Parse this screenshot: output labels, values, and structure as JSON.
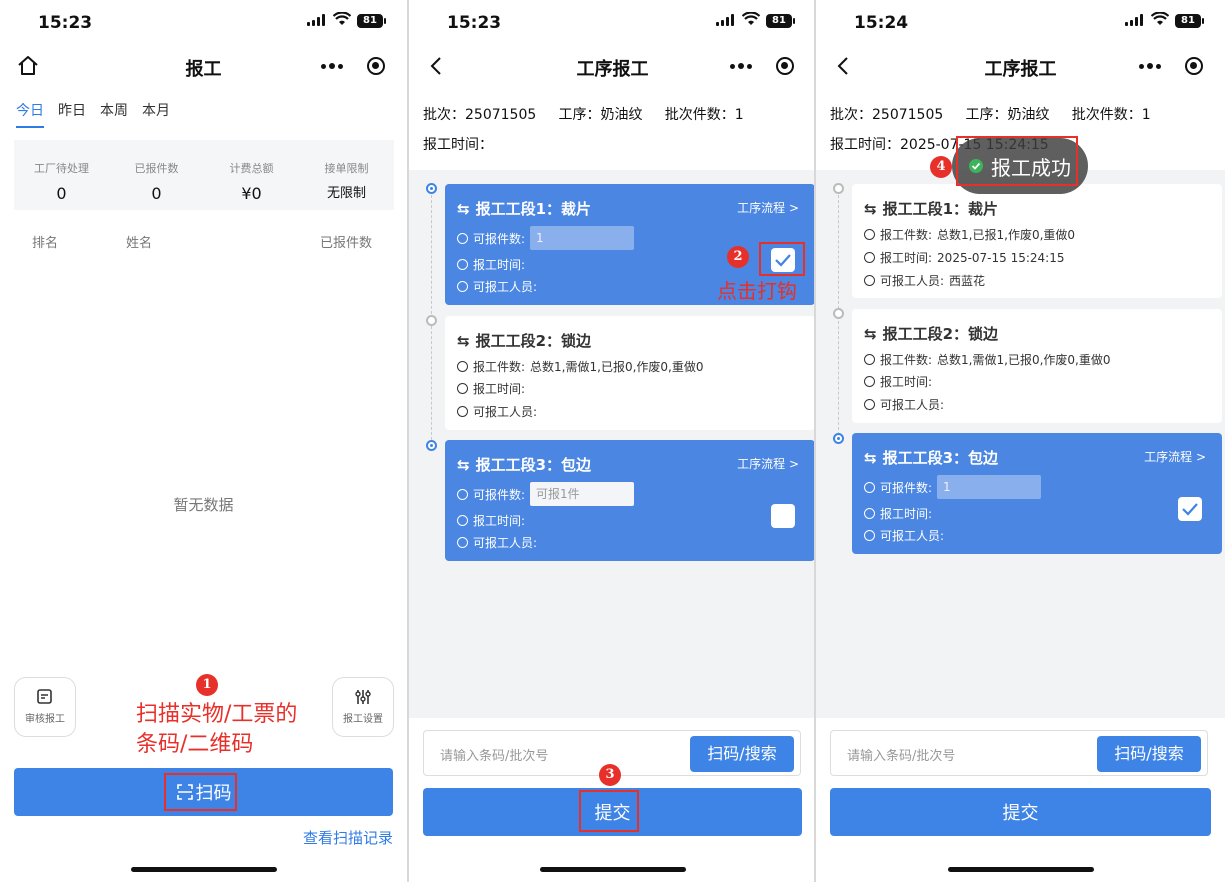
{
  "screen1": {
    "time": "15:23",
    "battery": "81",
    "nav_title": "报工",
    "tabs": [
      "今日",
      "昨日",
      "本周",
      "本月"
    ],
    "stats": [
      {
        "label": "工厂待处理",
        "value": "0"
      },
      {
        "label": "已报件数",
        "value": "0"
      },
      {
        "label": "计费总额",
        "value": "¥0"
      },
      {
        "label": "接单限制",
        "value": "无限制"
      }
    ],
    "rank_headers": [
      "排名",
      "姓名",
      "已报件数"
    ],
    "empty_text": "暂无数据",
    "review_button": "审核报工",
    "settings_button": "报工设置",
    "annotation_num": "1",
    "annotation_text_1": "扫描实物/工票的",
    "annotation_text_2": "条码/二维码",
    "scan_button": "扫码",
    "scan_record_link": "查看扫描记录"
  },
  "screen2": {
    "time": "15:23",
    "battery": "81",
    "nav_title": "工序报工",
    "batch_label": "批次：25071505",
    "process_label": "工序：奶油纹",
    "batch_qty_label": "批次件数：1",
    "report_time_label": "报工时间：",
    "cards": [
      {
        "title": "报工工段1：裁片",
        "flow": "工序流程 >",
        "qty_label": "可报件数:",
        "qty_value": "1",
        "time_label": "报工时间:",
        "staff_label": "可报工人员:"
      },
      {
        "title": "报工工段2：锁边",
        "qty_label": "报工件数:",
        "qty_text": "总数1,需做1,已报0,作废0,重做0",
        "time_label": "报工时间:",
        "staff_label": "可报工人员:"
      },
      {
        "title": "报工工段3：包边",
        "flow": "工序流程 >",
        "qty_label": "可报件数:",
        "qty_placeholder": "可报1件",
        "time_label": "报工时间:",
        "staff_label": "可报工人员:"
      }
    ],
    "annotation_num_2": "2",
    "annotation_text_2": "点击打钩",
    "annotation_num_3": "3",
    "search_placeholder": "请输入条码/批次号",
    "search_button": "扫码/搜索",
    "submit_button": "提交"
  },
  "screen3": {
    "time": "15:24",
    "battery": "81",
    "nav_title": "工序报工",
    "batch_label": "批次：25071505",
    "process_label": "工序：奶油纹",
    "batch_qty_label": "批次件数：1",
    "report_time_label": "报工时间：2025-07-15 15:24:15",
    "toast_text": "报工成功",
    "annotation_num_4": "4",
    "cards": [
      {
        "title": "报工工段1：裁片",
        "qty_label": "报工件数:",
        "qty_text": "总数1,已报1,作废0,重做0",
        "time_label": "报工时间:",
        "time_value": "2025-07-15 15:24:15",
        "staff_label": "可报工人员:",
        "staff_value": "西蓝花"
      },
      {
        "title": "报工工段2：锁边",
        "qty_label": "报工件数:",
        "qty_text": "总数1,需做1,已报0,作废0,重做0",
        "time_label": "报工时间:",
        "staff_label": "可报工人员:"
      },
      {
        "title": "报工工段3：包边",
        "flow": "工序流程 >",
        "qty_label": "可报件数:",
        "qty_value": "1",
        "time_label": "报工时间:",
        "staff_label": "可报工人员:"
      }
    ],
    "search_placeholder": "请输入条码/批次号",
    "search_button": "扫码/搜索",
    "submit_button": "提交"
  },
  "colors": {
    "primary": "#3e84e6",
    "card_blue": "#4a86e2",
    "annotation_red": "#e8302a",
    "success_green": "#3cb55a"
  }
}
